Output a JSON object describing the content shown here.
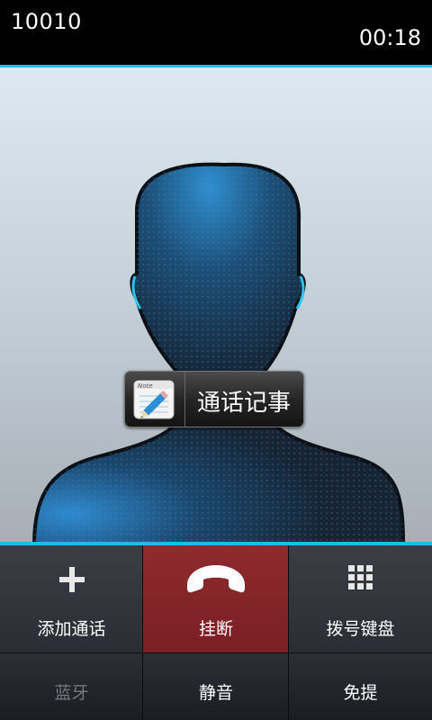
{
  "call": {
    "number": "10010",
    "duration": "00:18"
  },
  "note_button": {
    "label": "通话记事",
    "icon": "note-pencil-icon"
  },
  "controls": {
    "add_call": {
      "label": "添加通话",
      "icon": "plus-icon"
    },
    "hang_up": {
      "label": "挂断",
      "icon": "phone-hangup-icon",
      "color": "#8e2a2f"
    },
    "dialpad": {
      "label": "拨号键盘",
      "icon": "dialpad-icon"
    },
    "bluetooth": {
      "label": "蓝牙",
      "enabled": false
    },
    "mute": {
      "label": "静音"
    },
    "speaker": {
      "label": "免提"
    }
  },
  "colors": {
    "accent": "#21b8ea",
    "hangup": "#8e2a2f"
  }
}
